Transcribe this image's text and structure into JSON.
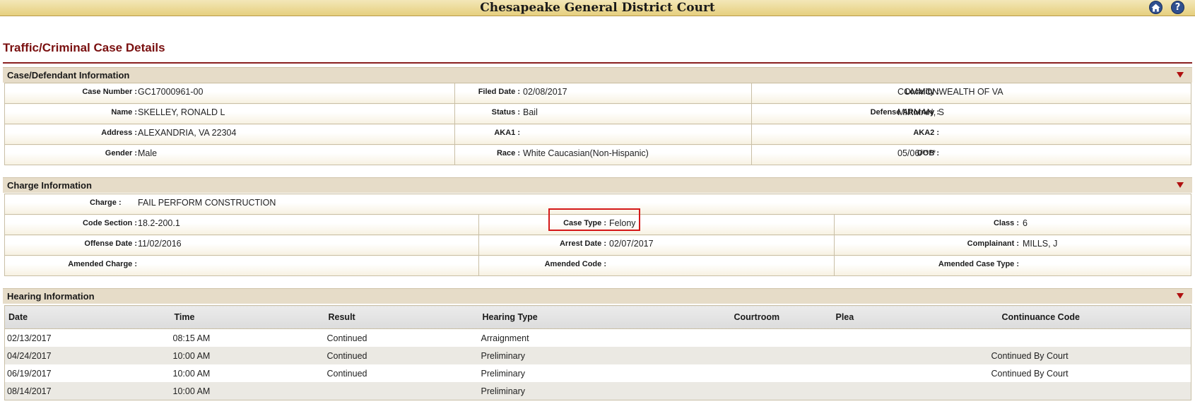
{
  "header": {
    "title": "Chesapeake General District Court",
    "home_icon": "home-icon",
    "help_icon": "help-icon",
    "help_glyph": "?",
    "brand_color": "#e6cf7e"
  },
  "page": {
    "title": "Traffic/Criminal Case Details",
    "accent_color": "#7a1010"
  },
  "case_section": {
    "title": "Case/Defendant Information",
    "rows": [
      [
        {
          "label": "Case Number :",
          "value": "GC17000961-00"
        },
        {
          "label": "Filed Date :",
          "value": "02/08/2017"
        },
        {
          "label": "Locality :",
          "value": "COMMONWEALTH OF VA"
        }
      ],
      [
        {
          "label": "Name :",
          "value": "SKELLEY, RONALD L"
        },
        {
          "label": "Status :",
          "value": "Bail"
        },
        {
          "label": "Defense Attorney :",
          "value": "MIRMAN, S"
        }
      ],
      [
        {
          "label": "Address :",
          "value": "ALEXANDRIA, VA 22304"
        },
        {
          "label": "AKA1 :",
          "value": ""
        },
        {
          "label": "AKA2 :",
          "value": ""
        }
      ],
      [
        {
          "label": "Gender :",
          "value": "Male"
        },
        {
          "label": "Race :",
          "value": "White Caucasian(Non-Hispanic)"
        },
        {
          "label": "DOB :",
          "value": "05/06/****"
        }
      ]
    ]
  },
  "charge_section": {
    "title": "Charge Information",
    "charge": {
      "label": "Charge :",
      "value": "FAIL PERFORM CONSTRUCTION"
    },
    "rows": [
      [
        {
          "label": "Code Section :",
          "value": "18.2-200.1"
        },
        {
          "label": "Case Type :",
          "value": "Felony"
        },
        {
          "label": "Class :",
          "value": "6"
        }
      ],
      [
        {
          "label": "Offense Date :",
          "value": "11/02/2016"
        },
        {
          "label": "Arrest Date :",
          "value": "02/07/2017"
        },
        {
          "label": "Complainant :",
          "value": "MILLS, J"
        }
      ],
      [
        {
          "label": "Amended Charge :",
          "value": ""
        },
        {
          "label": "Amended Code :",
          "value": ""
        },
        {
          "label": "Amended Case Type :",
          "value": ""
        }
      ]
    ]
  },
  "hearing_section": {
    "title": "Hearing Information",
    "columns": [
      "Date",
      "Time",
      "Result",
      "Hearing Type",
      "Courtroom",
      "Plea",
      "Continuance Code"
    ],
    "rows": [
      [
        "02/13/2017",
        "08:15 AM",
        "Continued",
        "Arraignment",
        "",
        "",
        ""
      ],
      [
        "04/24/2017",
        "10:00 AM",
        "Continued",
        "Preliminary",
        "",
        "",
        "Continued By Court"
      ],
      [
        "06/19/2017",
        "10:00 AM",
        "Continued",
        "Preliminary",
        "",
        "",
        "Continued By Court"
      ],
      [
        "08/14/2017",
        "10:00 AM",
        "",
        "Preliminary",
        "",
        "",
        ""
      ]
    ]
  }
}
